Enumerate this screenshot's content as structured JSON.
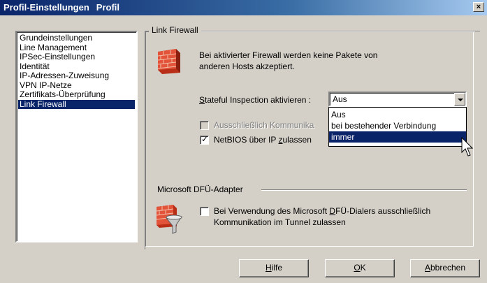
{
  "window": {
    "title": "Profil-Einstellungen",
    "subtitle": "Profil",
    "close_glyph": "×"
  },
  "nav": {
    "items": [
      "Grundeinstellungen",
      "Line Management",
      "IPSec-Einstellungen",
      "Identität",
      "IP-Adressen-Zuweisung",
      "VPN IP-Netze",
      "Zertifikats-Überprüfung",
      "Link Firewall"
    ],
    "selected": "Link Firewall"
  },
  "link_firewall": {
    "group_title": "Link Firewall",
    "description_line1": "Bei aktivierter Firewall werden keine Pakete von",
    "description_line2": "anderen Hosts akzeptiert.",
    "stateful_label_prefix": "",
    "stateful_label_ul": "S",
    "stateful_label_rest": "tateful Inspection aktivieren :",
    "stateful_value": "Aus",
    "stateful_options": [
      "Aus",
      "bei bestehender Verbindung",
      "immer"
    ],
    "stateful_highlighted": "immer",
    "only_comm_label": "Ausschließlich Kommunika",
    "only_comm_checked": false,
    "netbios_label_prefix": "NetBIOS über IP ",
    "netbios_label_ul": "z",
    "netbios_label_rest": "ulassen",
    "netbios_checked": true,
    "icon": "firewall-brick-icon"
  },
  "dfu": {
    "group_title": "Microsoft DFÜ-Adapter",
    "line1_prefix": "Bei Verwendung des Microsoft ",
    "line1_ul": "D",
    "line1_rest": "FÜ-Dialers ausschließlich",
    "line2": "Kommunikation im Tunnel zulassen",
    "checked": false,
    "icon": "firewall-funnel-icon"
  },
  "buttons": {
    "help_ul": "H",
    "help_rest": "ilfe",
    "ok_ul": "O",
    "ok_rest": "K",
    "cancel_ul": "A",
    "cancel_rest": "bbrechen"
  },
  "colors": {
    "title_gradient_start": "#0a246a",
    "title_gradient_end": "#a6caf0",
    "selection": "#0a246a",
    "face": "#d4d0c8",
    "brick": "#d9452b"
  }
}
